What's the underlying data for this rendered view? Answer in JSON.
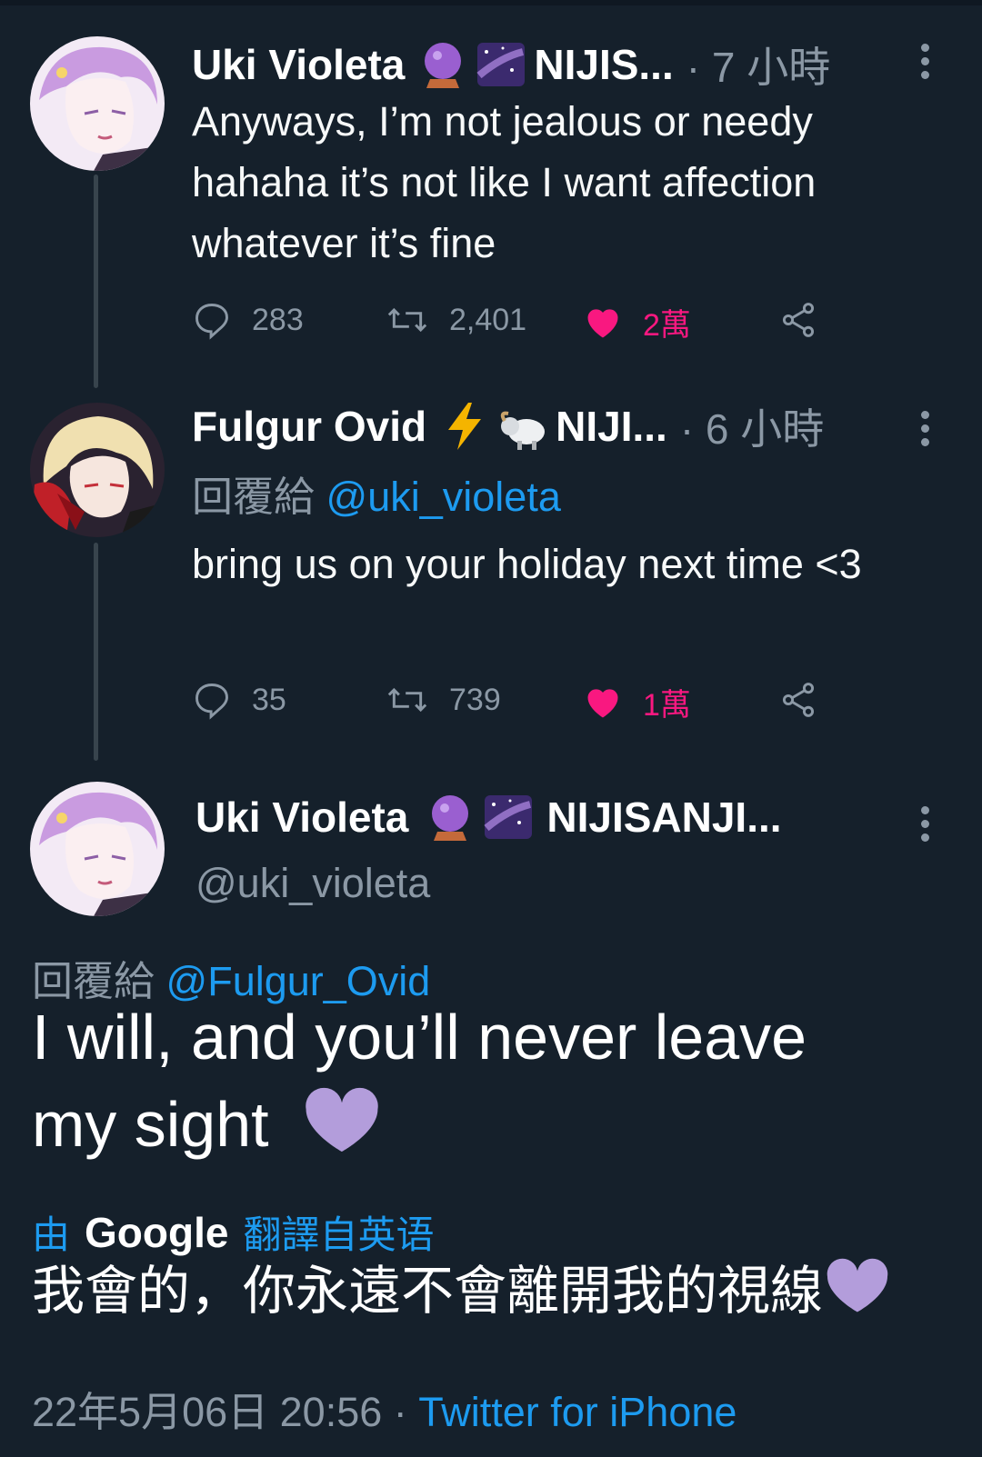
{
  "colors": {
    "background": "#15202b",
    "secondary_text": "#8b98a5",
    "link": "#1d9bf0",
    "like": "#f91880",
    "thread_line": "#38444d"
  },
  "tweet1": {
    "author": "Uki Violeta",
    "badge_icons": [
      "crystal-ball-icon",
      "milky-way-icon"
    ],
    "group_truncated": "NIJIS...",
    "time": "· 7 小時",
    "text": "Anyways, I’m not jealous or needy hahaha it’s not like I want affection whatever it’s fine",
    "replies": "283",
    "retweets": "2,401",
    "likes": "2萬"
  },
  "tweet2": {
    "author": "Fulgur Ovid",
    "badge_icons": [
      "lightning-icon",
      "ram-icon"
    ],
    "group_truncated": "NIJI...",
    "time": "· 6 小時",
    "reply_prefix": "回覆給",
    "reply_handle": "@uki_violeta",
    "text": "bring us on your holiday next time <3",
    "replies": "35",
    "retweets": "739",
    "likes": "1萬"
  },
  "main_tweet": {
    "author": "Uki Violeta",
    "badge_icons": [
      "crystal-ball-icon",
      "milky-way-icon"
    ],
    "group_truncated": "NIJISANJI...",
    "handle": "@uki_violeta",
    "reply_prefix": "回覆給",
    "reply_handle": "@Fulgur_Ovid",
    "text": "I will, and you’ll never leave my sight",
    "translate_prefix": "由",
    "translate_brand": "Google",
    "translate_suffix": "翻譯自英语",
    "translated_text": "我會的，你永遠不會離開我的視線",
    "date": "22年5月06日 20:56",
    "separator": " · ",
    "client": "Twitter for iPhone"
  }
}
